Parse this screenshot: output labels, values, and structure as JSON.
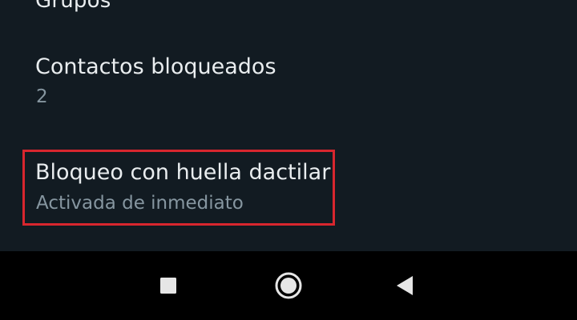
{
  "previous_item": {
    "title_partial": "Grupos"
  },
  "settings": {
    "blocked_contacts": {
      "title": "Contactos bloqueados",
      "value": "2"
    },
    "fingerprint_lock": {
      "title": "Bloqueo con huella dactilar",
      "status": "Activada de inmediato"
    }
  },
  "highlight": {
    "color": "#d8262e"
  },
  "navigation_bar": {
    "buttons": [
      "recents-icon",
      "home-icon",
      "back-icon"
    ]
  },
  "colors": {
    "background": "#121b22",
    "primary_text": "#e9edef",
    "secondary_text": "#8696a0",
    "nav_background": "#000000"
  }
}
